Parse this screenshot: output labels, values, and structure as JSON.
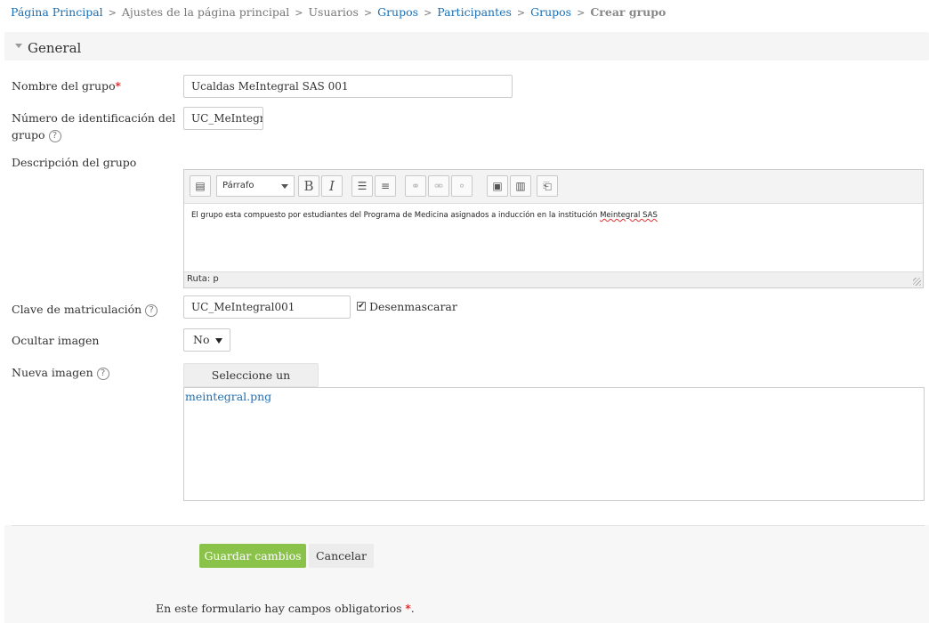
{
  "breadcrumb": [
    {
      "label": "Página Principal",
      "link": true
    },
    {
      "label": "Ajustes de la página principal",
      "link": false
    },
    {
      "label": "Usuarios",
      "link": false
    },
    {
      "label": "Grupos",
      "link": true
    },
    {
      "label": "Participantes",
      "link": true
    },
    {
      "label": "Grupos",
      "link": true
    },
    {
      "label": "Crear grupo",
      "link": false
    }
  ],
  "section": {
    "legend": "General"
  },
  "fields": {
    "name": {
      "label": "Nombre del grupo",
      "required": "*",
      "value": "Ucaldas MeIntegral SAS 001"
    },
    "idnumber": {
      "label_line1": "Número de identificación del",
      "label_line2": "grupo",
      "value": "UC_MeIntegral"
    },
    "description": {
      "label": "Descripción del grupo",
      "format": "Párrafo",
      "content_before": "El grupo esta compuesto por estudiantes del Programa de Medicina asignados a inducción en la institución ",
      "content_spell": "Meintegral SAS",
      "path": "Ruta: p"
    },
    "enrolmentkey": {
      "label": "Clave de matriculación",
      "value": "UC_MeIntegral001",
      "unmask_label": "Desenmascarar",
      "unmask_checked": true
    },
    "hidepicture": {
      "label": "Ocultar imagen",
      "value": "No"
    },
    "imagefile": {
      "label": "Nueva imagen",
      "button": "Seleccione un archivo...",
      "file": "meintegral.png"
    }
  },
  "actions": {
    "save": "Guardar cambios",
    "cancel": "Cancelar"
  },
  "required_note": {
    "text": "En este formulario hay campos obligatorios ",
    "mark": "*",
    "end": "."
  },
  "icons": {
    "help": "?",
    "check": "✔"
  },
  "colors": {
    "link": "#1a6fb5",
    "primary": "#8bc34a",
    "required": "#cc0000"
  }
}
